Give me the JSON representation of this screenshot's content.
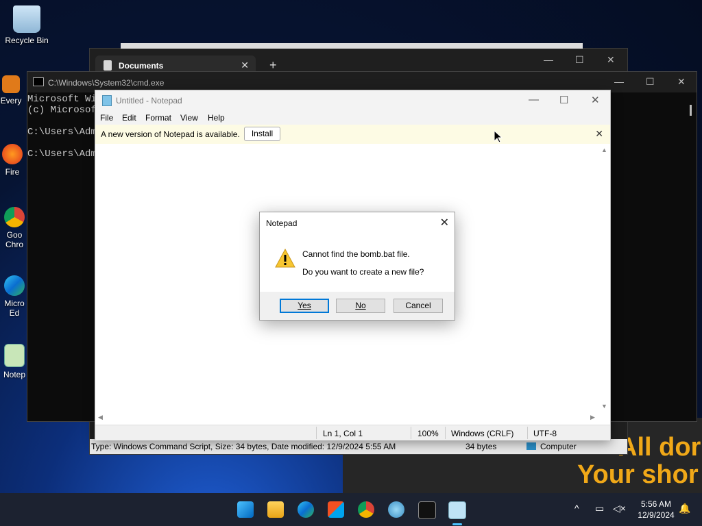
{
  "desktop": {
    "icons": [
      {
        "label": "Recycle Bin"
      },
      {
        "label": "Every"
      },
      {
        "label": "Fire"
      },
      {
        "label": "Goo Chro"
      },
      {
        "label": "Micro Ed"
      },
      {
        "label": "Notep"
      }
    ],
    "promo": {
      "line1": "All dor",
      "line2": "Your shor"
    }
  },
  "explorer": {
    "tab_title": "Documents",
    "status": {
      "info": "Type: Windows Command Script, Size: 34 bytes, Date modified: 12/9/2024 5:55 AM",
      "size": "34 bytes",
      "location": "Computer"
    }
  },
  "cmd": {
    "title": "C:\\Windows\\System32\\cmd.exe",
    "lines": "Microsoft Wi\n(c) Microsof\n\nC:\\Users\\Adm\n\nC:\\Users\\Adm"
  },
  "notepad": {
    "title": "Untitled - Notepad",
    "menu": [
      "File",
      "Edit",
      "Format",
      "View",
      "Help"
    ],
    "banner": {
      "message": "A new version of Notepad is available.",
      "install_label": "Install"
    },
    "status": {
      "position": "Ln 1, Col 1",
      "zoom": "100%",
      "line_ending": "Windows (CRLF)",
      "encoding": "UTF-8"
    }
  },
  "dialog": {
    "title": "Notepad",
    "message1": "Cannot find the bomb.bat file.",
    "message2": "Do you want to create a new file?",
    "yes_label": "Yes",
    "no_label": "No",
    "cancel_label": "Cancel"
  },
  "taskbar": {
    "icons": [
      "start-icon",
      "file-explorer-icon",
      "edge-icon",
      "store-icon",
      "chrome-icon",
      "network-app-icon",
      "terminal-icon",
      "notepad-icon"
    ],
    "time": "5:56 AM",
    "date": "12/9/2024"
  },
  "colors": {
    "accent": "#0078d7",
    "promo_text": "#f0a818"
  }
}
